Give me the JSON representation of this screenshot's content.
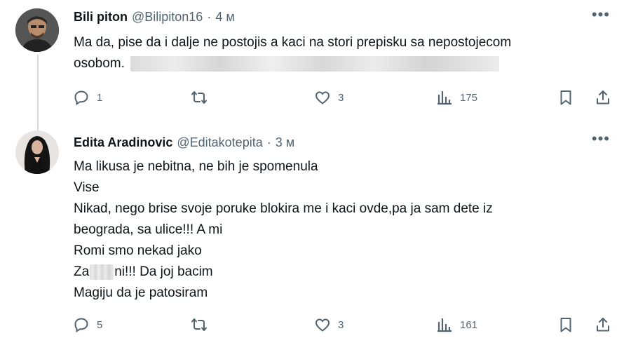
{
  "tweets": [
    {
      "name": "Bili piton",
      "handle": "@Bilipiton16",
      "separator": "·",
      "time": "4 м",
      "more": "•••",
      "text_lines": [
        "Ma da, pise da i dalje ne postojis a kaci na stori prepisku sa nepostojecom",
        "osobom."
      ],
      "stats": {
        "replies": "1",
        "reposts": "",
        "likes": "3",
        "views": "175"
      }
    },
    {
      "name": "Edita Aradinovic",
      "handle": "@Editakotepita",
      "separator": "·",
      "time": "3 м",
      "more": "•••",
      "text_lines": [
        "Ma likusa je nebitna, ne bih je spomenula",
        "Vise",
        "Nikad, nego brise svoje poruke blokira me i kaci ovde,pa ja sam dete iz",
        "beograda, sa ulice!!! A mi",
        "Romi smo nekad jako",
        "Za",
        "ni!!! Da joj bacim",
        "Magiju da je patosiram"
      ],
      "stats": {
        "replies": "5",
        "reposts": "",
        "likes": "3",
        "views": "161"
      }
    }
  ],
  "icons": [
    "reply-icon",
    "repost-icon",
    "like-icon",
    "views-icon",
    "bookmark-icon",
    "share-icon"
  ],
  "colors": {
    "text": "#0f1419",
    "secondary": "#536471",
    "thread_line": "#cfd9de"
  }
}
